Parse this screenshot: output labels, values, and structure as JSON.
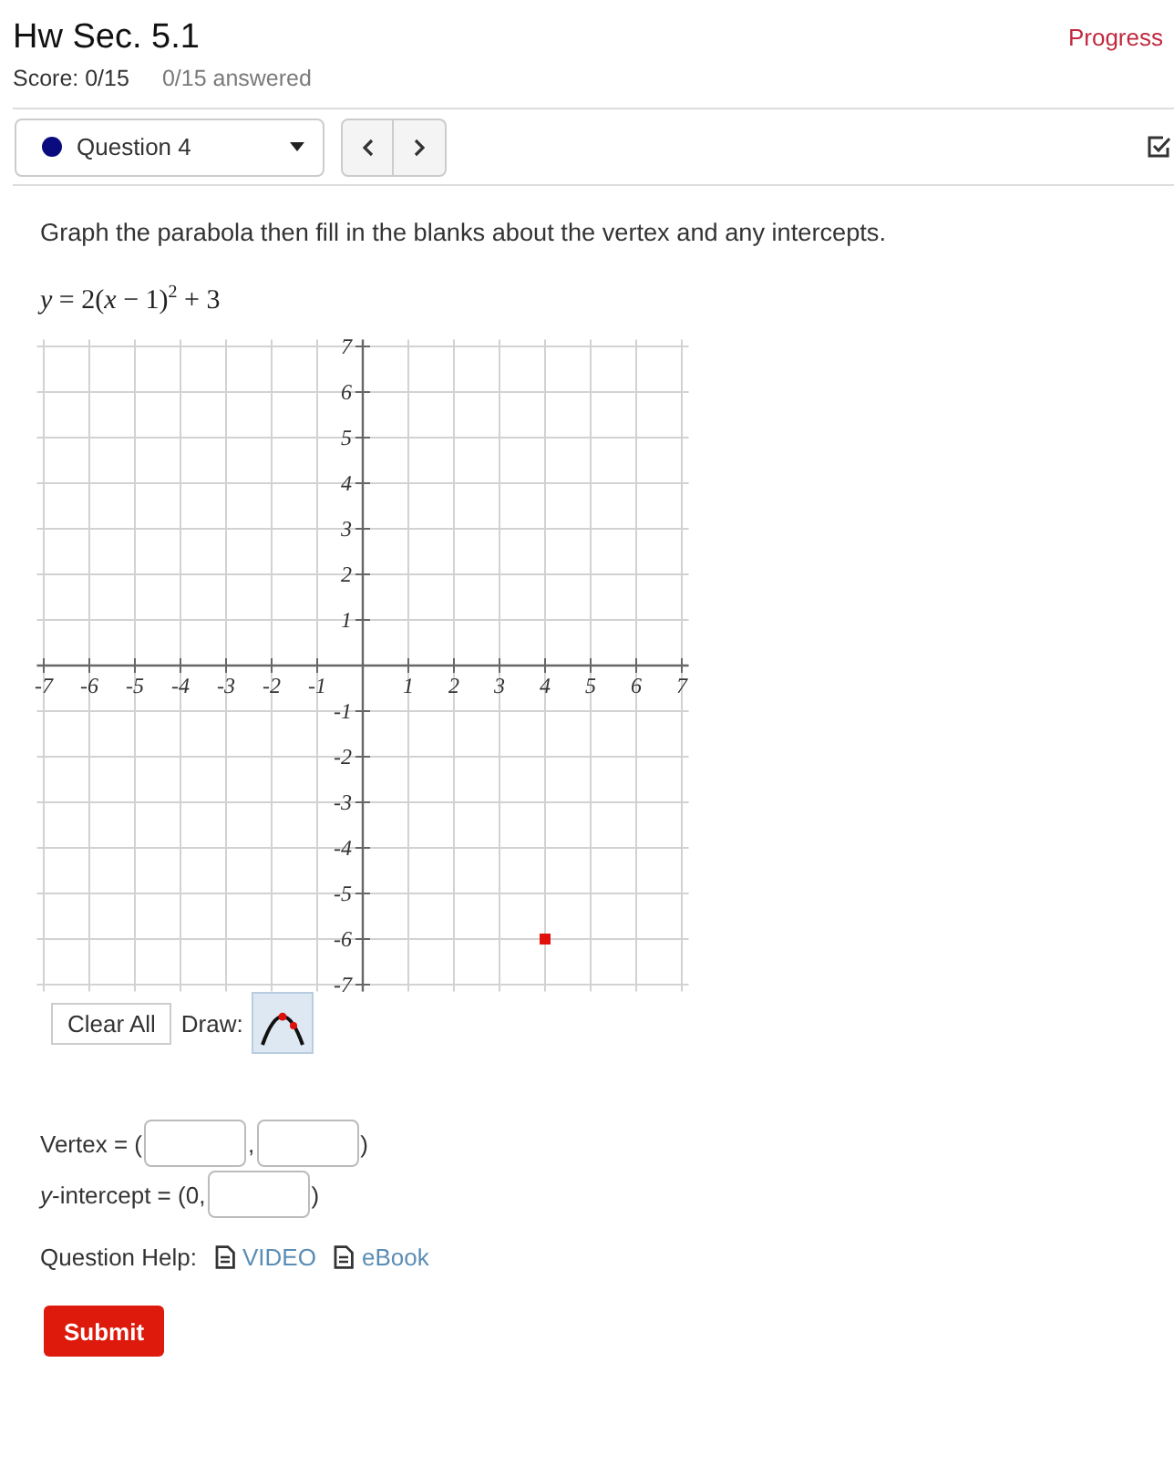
{
  "header": {
    "title": "Hw Sec. 5.1",
    "progress": "Progress",
    "score": "Score: 0/15",
    "answered": "0/15 answered"
  },
  "toolbar": {
    "question": "Question 4"
  },
  "question": {
    "instruction": "Graph the parabola then fill in the blanks about the vertex and any intercepts.",
    "equation": "*y* = 2(*x* − 1)$^{2}$ + 3"
  },
  "graph": {
    "chart_data": {
      "type": "scatter",
      "x": [
        4
      ],
      "series": [
        {
          "color": "#e0100c",
          "values": [
            -6
          ]
        }
      ],
      "xlim": [
        -7.15,
        7.15
      ],
      "ylim": [
        -7.15,
        7.15
      ],
      "xticks": [
        -7,
        -6,
        -5,
        -4,
        -3,
        -2,
        -1,
        1,
        2,
        3,
        4,
        5,
        6,
        7
      ],
      "yticks": [
        -7,
        -6,
        -5,
        -4,
        -3,
        -2,
        -1,
        1,
        2,
        3,
        4,
        5,
        6,
        7
      ],
      "grid": true
    }
  },
  "graph_controls": {
    "clear_label": "Clear All",
    "draw_label": "Draw:",
    "draw_tools": [
      {
        "kind": "parabola",
        "selected": true
      }
    ]
  },
  "answers": [
    {
      "kind": "pair",
      "prefix": "Vertex = (",
      "separator": ",",
      "suffix": ")"
    },
    {
      "kind": "single",
      "prefix": "*y*-intercept = (0,",
      "suffix": ")"
    }
  ],
  "question_help": {
    "label": "Question Help:",
    "links": [
      {
        "label": "VIDEO"
      },
      {
        "label": "eBook"
      }
    ]
  },
  "submit": "Submit"
}
